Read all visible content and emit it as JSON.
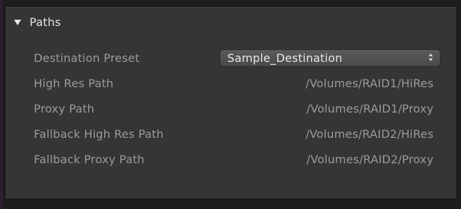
{
  "section": {
    "title": "Paths",
    "expanded": true,
    "disclosure_icon": "triangle-down-icon"
  },
  "destination_preset": {
    "label": "Destination Preset",
    "selected": "Sample_Destination",
    "control_icon": "up-down-chevron-icon"
  },
  "rows": [
    {
      "label": "High Res Path",
      "value": "/Volumes/RAID1/HiRes"
    },
    {
      "label": "Proxy Path",
      "value": "/Volumes/RAID1/Proxy"
    },
    {
      "label": "Fallback High Res Path",
      "value": "/Volumes/RAID2/HiRes"
    },
    {
      "label": "Fallback Proxy Path",
      "value": "/Volumes/RAID2/Proxy"
    }
  ],
  "colors": {
    "panel_background": "#353536",
    "label_text": "#9a9a9b",
    "header_text": "#e6e6e6"
  }
}
